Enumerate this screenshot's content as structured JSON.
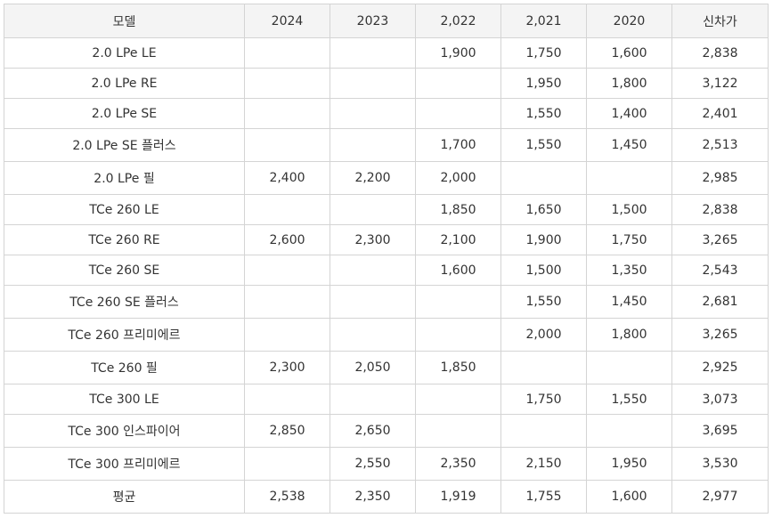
{
  "table": {
    "headers": [
      "모델",
      "2024",
      "2023",
      "2,022",
      "2,021",
      "2020",
      "신차가"
    ],
    "rows": [
      [
        "2.0 LPe LE",
        "",
        "",
        "1,900",
        "1,750",
        "1,600",
        "2,838"
      ],
      [
        "2.0 LPe RE",
        "",
        "",
        "",
        "1,950",
        "1,800",
        "3,122"
      ],
      [
        "2.0 LPe SE",
        "",
        "",
        "",
        "1,550",
        "1,400",
        "2,401"
      ],
      [
        "2.0 LPe SE 플러스",
        "",
        "",
        "1,700",
        "1,550",
        "1,450",
        "2,513"
      ],
      [
        "2.0 LPe 필",
        "2,400",
        "2,200",
        "2,000",
        "",
        "",
        "2,985"
      ],
      [
        "TCe 260 LE",
        "",
        "",
        "1,850",
        "1,650",
        "1,500",
        "2,838"
      ],
      [
        "TCe 260 RE",
        "2,600",
        "2,300",
        "2,100",
        "1,900",
        "1,750",
        "3,265"
      ],
      [
        "TCe 260 SE",
        "",
        "",
        "1,600",
        "1,500",
        "1,350",
        "2,543"
      ],
      [
        "TCe 260 SE 플러스",
        "",
        "",
        "",
        "1,550",
        "1,450",
        "2,681"
      ],
      [
        "TCe 260 프리미에르",
        "",
        "",
        "",
        "2,000",
        "1,800",
        "3,265"
      ],
      [
        "TCe 260 필",
        "2,300",
        "2,050",
        "1,850",
        "",
        "",
        "2,925"
      ],
      [
        "TCe 300 LE",
        "",
        "",
        "",
        "1,750",
        "1,550",
        "3,073"
      ],
      [
        "TCe 300 인스파이어",
        "2,850",
        "2,650",
        "",
        "",
        "",
        "3,695"
      ],
      [
        "TCe 300 프리미에르",
        "",
        "2,550",
        "2,350",
        "2,150",
        "1,950",
        "3,530"
      ],
      [
        "평균",
        "2,538",
        "2,350",
        "1,919",
        "1,755",
        "1,600",
        "2,977"
      ]
    ]
  }
}
